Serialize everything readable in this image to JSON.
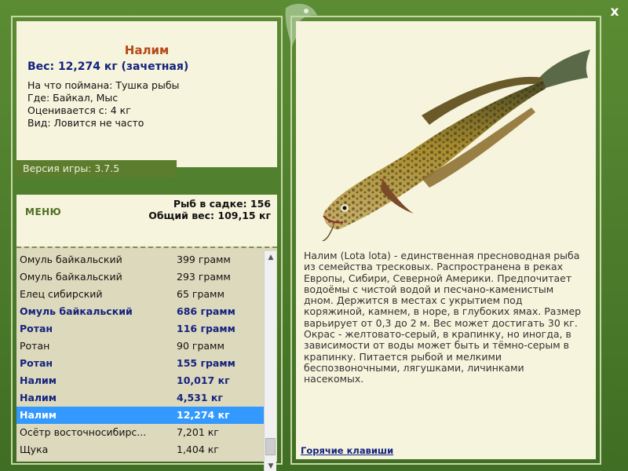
{
  "fish": {
    "title": "Налим",
    "weight": "Вес: 12,274 кг (зачетная)",
    "info": [
      "На что поймана: Тушка рыбы",
      "Где: Байкал, Мыс",
      "Оценивается с: 4 кг",
      "Вид: Ловится не часто"
    ],
    "description": "Налим (Lota lota) - единственная пресноводная рыба из семейства тресковых. Распространена в реках Европы, Сибири, Северной Америки. Предпочитает водоёмы с чистой водой и песчано-каменистым дном. Держится в местах с укрытием под коряжиной, камнем, в норе, в глубоких ямах. Размер варьирует от 0,3 до 2 м. Вес может достигать 30 кг. Окрас - желтовато-серый, в крапинку, но иногда, в зависимости от воды может быть и тёмно-серым в крапинку. Питается рыбой и мелкими беспозвоночными, лягушками, личинками насекомых."
  },
  "version_label": "Версия игры: 3.7.5",
  "menu_label": "МЕНЮ",
  "stats": {
    "count": "Рыб в садке: 156",
    "total": "Общий вес: 109,15 кг"
  },
  "catch_list": [
    {
      "name": "Омуль байкальский",
      "weight": "399 грамм",
      "bold": false,
      "selected": false
    },
    {
      "name": "Омуль байкальский",
      "weight": "293 грамм",
      "bold": false,
      "selected": false
    },
    {
      "name": "Елец сибирский",
      "weight": "65 грамм",
      "bold": false,
      "selected": false
    },
    {
      "name": "Омуль байкальский",
      "weight": "686 грамм",
      "bold": true,
      "selected": false
    },
    {
      "name": "Ротан",
      "weight": "116 грамм",
      "bold": true,
      "selected": false
    },
    {
      "name": "Ротан",
      "weight": "90 грамм",
      "bold": false,
      "selected": false
    },
    {
      "name": "Ротан",
      "weight": "155 грамм",
      "bold": true,
      "selected": false
    },
    {
      "name": "Налим",
      "weight": "10,017 кг",
      "bold": true,
      "selected": false
    },
    {
      "name": "Налим",
      "weight": "4,531 кг",
      "bold": true,
      "selected": false
    },
    {
      "name": "Налим",
      "weight": "12,274 кг",
      "bold": true,
      "selected": true
    },
    {
      "name": "Осётр восточносибирс...",
      "weight": "7,201 кг",
      "bold": false,
      "selected": false
    },
    {
      "name": "Щука",
      "weight": "1,404 кг",
      "bold": false,
      "selected": false
    }
  ],
  "hotkeys_label": "Горячие клавиши",
  "close_label": "x",
  "colors": {
    "frame": "#4a7a2c",
    "panel_bg": "#f6f4dc",
    "selected": "#3399ff",
    "title": "#b5481a",
    "bold_text": "#14237f"
  }
}
